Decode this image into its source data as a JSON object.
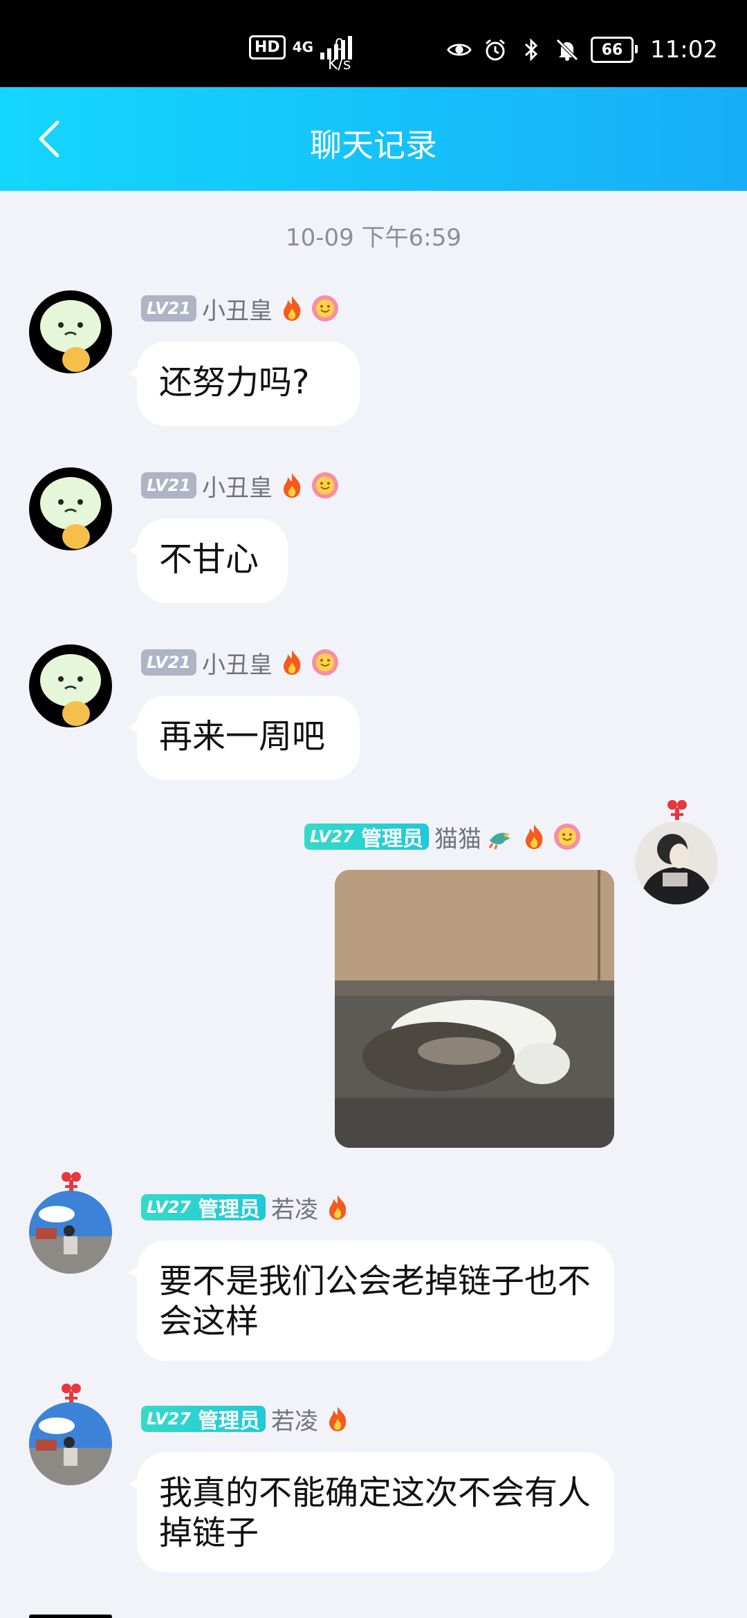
{
  "status_bar": {
    "hd": "HD",
    "network": "4G",
    "speed_value": "0",
    "speed_unit": "K/s",
    "battery": "66",
    "time": "11:02"
  },
  "header": {
    "title": "聊天记录"
  },
  "timestamp": "10-09 下午6:59",
  "messages": [
    {
      "level": "LV21",
      "nick": "小丑皇",
      "text": "还努力吗?"
    },
    {
      "level": "LV21",
      "nick": "小丑皇",
      "text": "不甘心"
    },
    {
      "level": "LV21",
      "nick": "小丑皇",
      "text": "再来一周吧"
    },
    {
      "level": "LV27",
      "role": "管理员",
      "nick": "猫猫",
      "image": "cat-photo"
    },
    {
      "level": "LV27",
      "role": "管理员",
      "nick": "若凌",
      "text": "要不是我们公会老掉链子也不会这样"
    },
    {
      "level": "LV27",
      "role": "管理员",
      "nick": "若凌",
      "text": "我真的不能确定这次不会有人掉链子"
    }
  ],
  "colors": {
    "header_start": "#14d7ff",
    "header_end": "#16aef7",
    "background": "#f2f3f8"
  }
}
